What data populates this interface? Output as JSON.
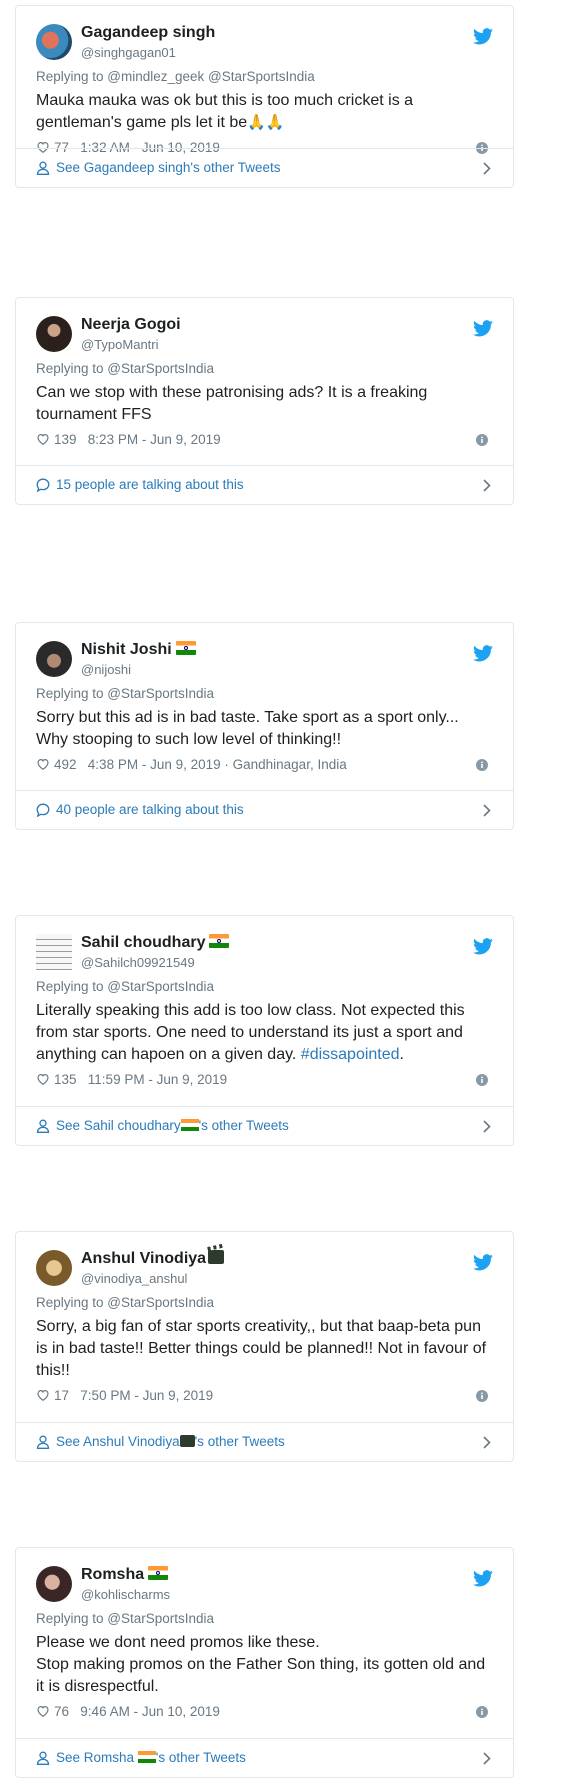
{
  "tweets": [
    {
      "name": "Gagandeep singh",
      "handle": "@singhgagan01",
      "replying_prefix": "Replying to ",
      "replying_to": "@mindlez_geek @StarSportsIndia",
      "text": "Mauka mauka was ok but this is too much cricket is a gentleman's game pls let it be",
      "emoji": "🙏🙏",
      "likes": "77",
      "meta": "1:32 AM - Jun 10, 2019",
      "footer": "See Gagandeep singh's other Tweets",
      "avatar_color": "#3a6f8f"
    },
    {
      "name": "Neerja Gogoi",
      "handle": "@TypoMantri",
      "replying_prefix": "Replying to ",
      "replying_to": "@StarSportsIndia",
      "text": "Can we stop with these patronising ads? It is a freaking tournament FFS",
      "likes": "139",
      "meta": "8:23 PM - Jun 9, 2019",
      "footer": "15 people are talking about this",
      "avatar_color": "#5a4a42"
    },
    {
      "name": "Nishit Joshi",
      "handle": "@nijoshi",
      "replying_prefix": "Replying to ",
      "replying_to": "@StarSportsIndia",
      "text": "Sorry but this ad is in bad taste. Take sport as a sport only...\nWhy stooping to such low level of thinking!!",
      "likes": "492",
      "meta": "4:38 PM - Jun 9, 2019 · Gandhinagar, India",
      "footer": "40 people are talking about this",
      "avatar_color": "#2e2e2e"
    },
    {
      "name": "Sahil choudhary",
      "handle": "@Sahilch09921549",
      "replying_prefix": "Replying to ",
      "replying_to": "@StarSportsIndia",
      "text": "Literally speaking this add is too low class. Not expected this from star sports. One need to understand its just a sport and anything can hapoen on a given day. ",
      "hashtag": "#dissapointed",
      "text_end": ".",
      "likes": "135",
      "meta": "11:59 PM - Jun 9, 2019",
      "footer_prefix": "See Sahil choudhary",
      "footer_suffix": "'s other Tweets",
      "avatar_color": "#f3f3f3"
    },
    {
      "name": "Anshul Vinodiya",
      "handle": "@vinodiya_anshul",
      "replying_prefix": "Replying to ",
      "replying_to": "@StarSportsIndia",
      "text": "Sorry, a big fan of star sports creativity,, but that baap-beta pun is in bad taste!! Better things could be planned!! Not in favour of this!!",
      "likes": "17",
      "meta": "7:50 PM - Jun 9, 2019",
      "footer_prefix": "See Anshul Vinodiya",
      "footer_suffix": "'s other Tweets",
      "avatar_color": "#a07a3c"
    },
    {
      "name": "Romsha",
      "handle": "@kohlischarms",
      "replying_prefix": "Replying to ",
      "replying_to": "@StarSportsIndia",
      "text": "Please we dont need promos like these.\nStop making promos on the Father Son thing, its gotten old and it is disrespectful.",
      "likes": "76",
      "meta": "9:46 AM - Jun 10, 2019",
      "footer_prefix": "See Romsha ",
      "footer_suffix": "'s other Tweets",
      "avatar_color": "#6a4a4a"
    }
  ],
  "colors": {
    "twitter_blue": "#1da1f2",
    "link_blue": "#2b7bb9",
    "meta_gray": "#697882",
    "border": "#e1e8ed"
  },
  "icons": {
    "bird": "twitter-bird-icon",
    "heart": "heart-icon",
    "info": "info-icon",
    "person": "person-icon",
    "comment": "comment-icon",
    "chevron": "chevron-right-icon"
  }
}
